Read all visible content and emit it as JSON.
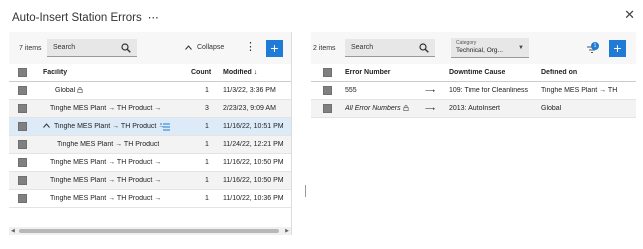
{
  "window": {
    "title": "Auto-Insert Station Errors",
    "more_icon": "more-horizontal-icon",
    "close_icon": "close-icon"
  },
  "left": {
    "items_count": "7 items",
    "search_placeholder": "Search",
    "collapse_label": "Collapse",
    "columns": {
      "facility": "Facility",
      "count": "Count",
      "modified": "Modified ↓"
    },
    "rows": [
      {
        "facility": "Global",
        "count": "1",
        "modified": "11/3/22, 3:36 PM",
        "locked": true,
        "indent": 1
      },
      {
        "facility": "Tinghe MES Plant → TH Product →",
        "count": "3",
        "modified": "2/23/23, 9:09 AM",
        "indent": 0
      },
      {
        "facility": "Tinghe MES Plant → TH Product →",
        "count": "1",
        "modified": "11/16/22, 10:51 PM",
        "expanded": true,
        "selected": true,
        "indent": 0
      },
      {
        "facility": "Tinghe MES Plant → TH Product",
        "count": "1",
        "modified": "11/24/22, 12:21 PM",
        "indent": 2
      },
      {
        "facility": "Tinghe MES Plant → TH Product →",
        "count": "1",
        "modified": "11/16/22, 10:50 PM",
        "indent": 0
      },
      {
        "facility": "Tinghe MES Plant → TH Product →",
        "count": "1",
        "modified": "11/16/22, 10:50 PM",
        "indent": 0
      },
      {
        "facility": "Tinghe MES Plant → TH Product →",
        "count": "1",
        "modified": "11/10/22, 10:36 PM",
        "indent": 0
      }
    ]
  },
  "right": {
    "items_count": "2 items",
    "search_placeholder": "Search",
    "category_label": "Category",
    "category_value": "Technical, Org...",
    "notification_count": "1",
    "columns": {
      "error_number": "Error Number",
      "downtime_cause": "Downtime Cause",
      "defined_on": "Defined on"
    },
    "rows": [
      {
        "error_number": "555",
        "arrow": "⟶",
        "downtime_cause": "109: Time for Cleanliness",
        "defined_on": "Tinghe MES Plant → TH"
      },
      {
        "error_number": "All Error Numbers",
        "arrow": "⟶",
        "downtime_cause": "2013: AutoInsert",
        "defined_on": "Global",
        "italic": true,
        "locked": true
      }
    ]
  },
  "colors": {
    "accent": "#1f7bd6",
    "selected_row": "#ddebf8",
    "checkbox": "#808080"
  }
}
